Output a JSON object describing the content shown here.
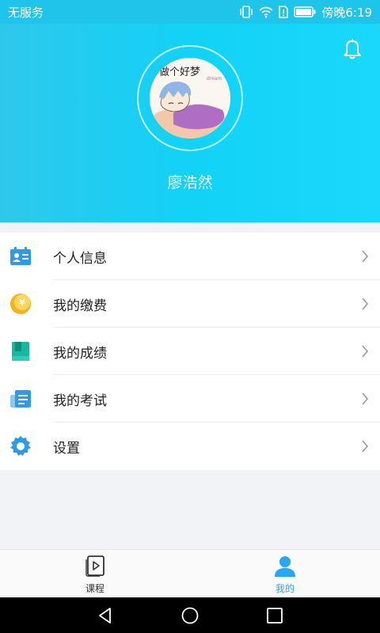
{
  "status_bar": {
    "carrier": "无服务",
    "time": "傍晚6:19"
  },
  "header": {
    "user_name": "廖浩然",
    "avatar_caption": "做个好梦",
    "avatar_caption_small": "dream"
  },
  "menu": {
    "items": [
      {
        "label": "个人信息",
        "icon": "id-card-icon",
        "color": "#2f9be8"
      },
      {
        "label": "我的缴费",
        "icon": "yuan-coin-icon",
        "color": "#f5b21e"
      },
      {
        "label": "我的成绩",
        "icon": "book-icon",
        "color": "#19b7a0"
      },
      {
        "label": "我的考试",
        "icon": "exam-paper-icon",
        "color": "#2f9be8"
      },
      {
        "label": "设置",
        "icon": "gear-icon",
        "color": "#2f9be8"
      }
    ]
  },
  "tabs": [
    {
      "label": "课程",
      "icon": "course-play-icon",
      "active": false
    },
    {
      "label": "我的",
      "icon": "person-icon",
      "active": true
    }
  ],
  "colors": {
    "accent": "#1fc4ea",
    "tab_active": "#2aa6f2",
    "tab_inactive": "#333333"
  }
}
